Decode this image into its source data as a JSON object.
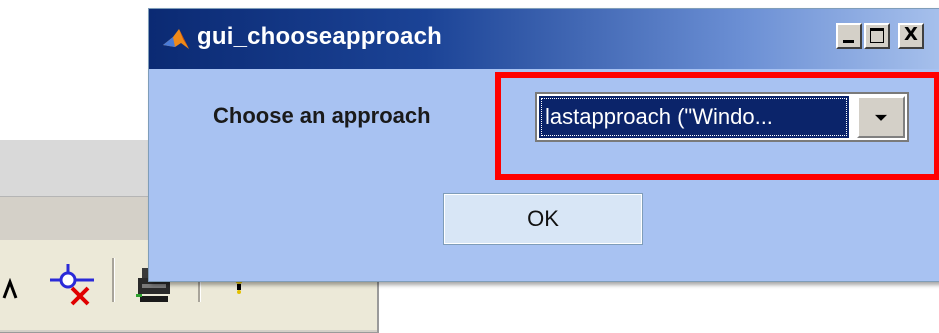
{
  "dialog": {
    "title": "gui_chooseapproach",
    "prompt_label": "Choose an approach",
    "selected_approach": "lastapproach (\"Windo...",
    "ok_label": "OK",
    "window_buttons": {
      "close_label": "X"
    },
    "icons": {
      "app": "matlab-logo-icon",
      "dropdown": "chevron-down-icon"
    }
  },
  "background_window": {
    "toolbar_icons": [
      "pointer-icon",
      "data-cursor-remove-icon",
      "print-icon",
      "push-pin-icon"
    ]
  },
  "colors": {
    "dialog_bg": "#a8c2f2",
    "titlebar_start": "#0b2a73",
    "highlight": "#ff0000",
    "selection_bg": "#0b246a"
  }
}
